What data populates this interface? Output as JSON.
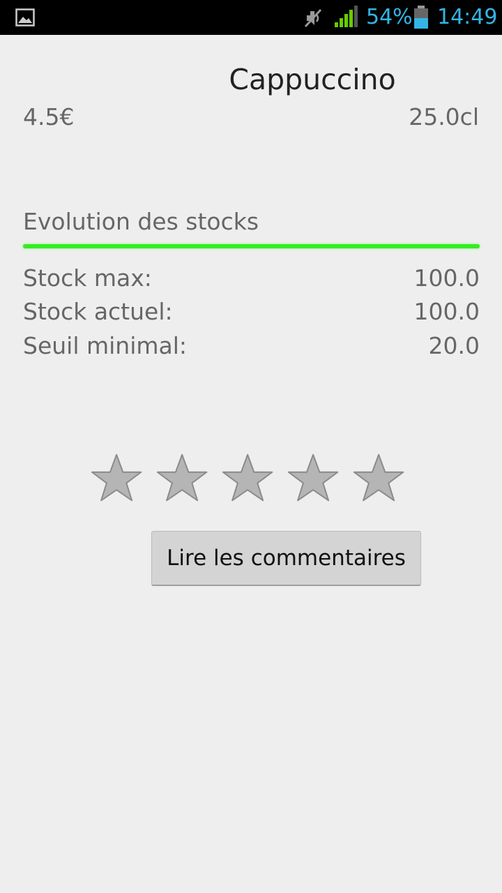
{
  "status_bar": {
    "battery_percent": "54%",
    "time": "14:49",
    "icons": [
      "gallery-icon",
      "mute-icon",
      "signal-icon",
      "battery-icon"
    ],
    "accent_color": "#33b5e5"
  },
  "product": {
    "name": "Cappuccino",
    "price": "4.5€",
    "volume": "25.0cl"
  },
  "stock": {
    "header": "Evolution des stocks",
    "level_fraction": 1.0,
    "bar_color": "#33ee22",
    "rows": [
      {
        "label": "Stock max:",
        "value": "100.0"
      },
      {
        "label": "Stock actuel:",
        "value": "100.0"
      },
      {
        "label": "Seuil minimal:",
        "value": "20.0"
      }
    ]
  },
  "rating": {
    "stars_total": 5,
    "stars_filled": 0
  },
  "actions": {
    "read_comments_label": "Lire les commentaires"
  }
}
